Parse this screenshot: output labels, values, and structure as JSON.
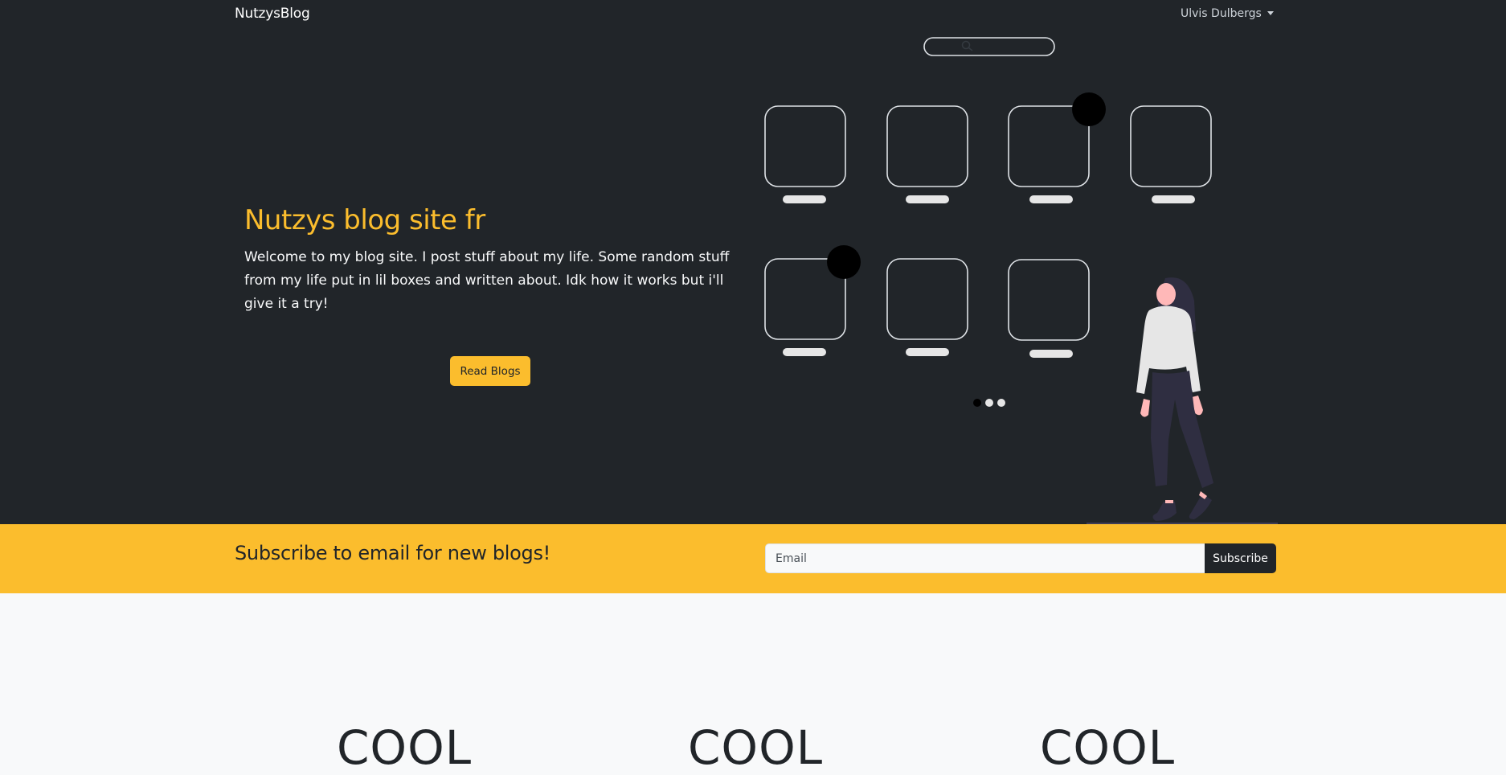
{
  "navbar": {
    "brand": "NutzysBlog",
    "user_name": "Ulvis Dulbergs"
  },
  "hero": {
    "title": "Nutzys blog site fr",
    "text": "Welcome to my blog site. I post stuff about my life. Some random stuff from my life put in lil boxes and written about. Idk how it works but i'll give it a try!",
    "button_label": "Read Blogs"
  },
  "subscribe": {
    "heading": "Subscribe to email for new blogs!",
    "email_placeholder": "Email",
    "button_label": "Subscribe"
  },
  "features": [
    {
      "title": "COOL"
    },
    {
      "title": "COOL"
    },
    {
      "title": "COOL"
    }
  ],
  "colors": {
    "dark": "#212529",
    "accent": "#fbbd2d",
    "light": "#f8f9fa"
  },
  "icons": {
    "search": "search-icon",
    "dropdown": "chevron-down-icon"
  }
}
